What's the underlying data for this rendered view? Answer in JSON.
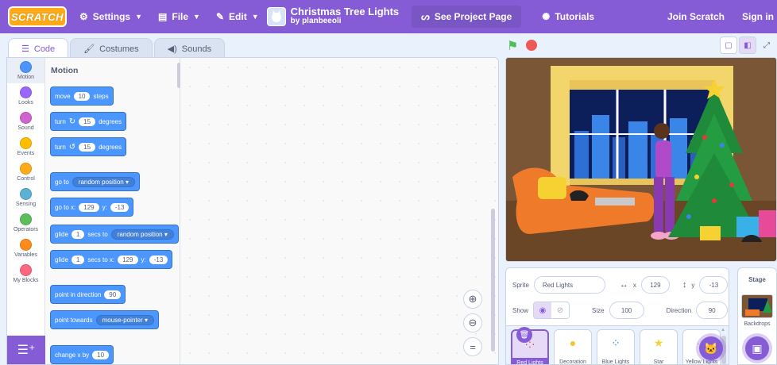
{
  "menubar": {
    "logo": "SCRATCH",
    "settings": "Settings",
    "file": "File",
    "edit": "Edit",
    "project_title": "Christmas Tree Lights",
    "project_author": "by planbeeoli",
    "see_project": "See Project Page",
    "tutorials": "Tutorials",
    "join": "Join Scratch",
    "sign_in": "Sign in"
  },
  "tabs": {
    "code": "Code",
    "costumes": "Costumes",
    "sounds": "Sounds"
  },
  "categories": [
    {
      "label": "Motion",
      "color": "#4c97ff"
    },
    {
      "label": "Looks",
      "color": "#9966ff"
    },
    {
      "label": "Sound",
      "color": "#cf63cf"
    },
    {
      "label": "Events",
      "color": "#ffbf00"
    },
    {
      "label": "Control",
      "color": "#ffab19"
    },
    {
      "label": "Sensing",
      "color": "#5cb1d6"
    },
    {
      "label": "Operators",
      "color": "#59c059"
    },
    {
      "label": "Variables",
      "color": "#ff8c1a"
    },
    {
      "label": "My Blocks",
      "color": "#ff6680"
    }
  ],
  "palette": {
    "heading": "Motion",
    "move": {
      "a": "move",
      "n": "10",
      "b": "steps"
    },
    "turn_right": {
      "a": "turn",
      "n": "15",
      "b": "degrees"
    },
    "turn_left": {
      "a": "turn",
      "n": "15",
      "b": "degrees"
    },
    "goto": {
      "a": "go to",
      "d": "random position"
    },
    "goto_xy": {
      "a": "go to x:",
      "x": "129",
      "b": "y:",
      "y": "-13"
    },
    "glide": {
      "a": "glide",
      "n": "1",
      "b": "secs to",
      "d": "random position"
    },
    "glide_xy": {
      "a": "glide",
      "n": "1",
      "b": "secs to x:",
      "x": "129",
      "c": "y:",
      "y": "-13"
    },
    "point_dir": {
      "a": "point in direction",
      "n": "90"
    },
    "point_towards": {
      "a": "point towards",
      "d": "mouse-pointer"
    },
    "change_x": {
      "a": "change x by",
      "n": "10"
    }
  },
  "sprite_info": {
    "sprite_label": "Sprite",
    "sprite_name": "Red Lights",
    "x_label": "x",
    "x": "129",
    "y_label": "y",
    "y": "-13",
    "show_label": "Show",
    "size_label": "Size",
    "size": "100",
    "direction_label": "Direction",
    "direction": "90"
  },
  "sprites": [
    "Red Lights",
    "Decoration",
    "Blue Lights",
    "Star",
    "Yellow Lights"
  ],
  "stage_panel": {
    "title": "Stage",
    "backdrops": "Backdrops"
  }
}
